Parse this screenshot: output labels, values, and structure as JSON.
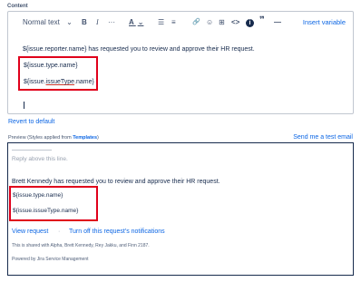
{
  "content_label": "Content",
  "toolbar": {
    "text_style": "Normal text",
    "text_style_chevron": "⌄",
    "bold": "B",
    "italic": "I",
    "more": "···",
    "text_color": "A",
    "text_color_chevron": "⌄",
    "bullet_list": "☰",
    "numbered_list": "≡",
    "link": "🔗",
    "emoji": "☺",
    "table": "⊞",
    "code": "<>",
    "info": "i",
    "quote": "❞",
    "divider": "—",
    "insert_variable": "Insert variable"
  },
  "editor": {
    "line1": "${issue.reporter.name} has requested you to review and approve their HR request.",
    "line2": "${issue.type.name}",
    "line3_prefix": "${issue.",
    "line3_underlined": "issueType",
    "line3_suffix": ".name}"
  },
  "revert_label": "Revert to default",
  "preview_label_prefix": "Preview (Styles applied from ",
  "preview_label_link": "Templates",
  "preview_label_suffix": ")",
  "send_test_email": "Send me a test email",
  "preview": {
    "reply_above": "Reply above this line.",
    "message": "Brett Kennedy has requested you to review and approve their HR request.",
    "var1": "${issue.type.name}",
    "var2": "${issue.issueType.name}",
    "view_request": "View request",
    "separator": "·",
    "turn_off": "Turn off this request's notifications",
    "shared_with": "This is shared with Alpha, Brett Kennedy, Rey Jakku, and Finn 2187.",
    "powered_by": "Powered by Jira Service Management"
  },
  "colors": {
    "link": "#0c66e4",
    "highlight_box": "#e0001b",
    "text": "#172b4d"
  }
}
